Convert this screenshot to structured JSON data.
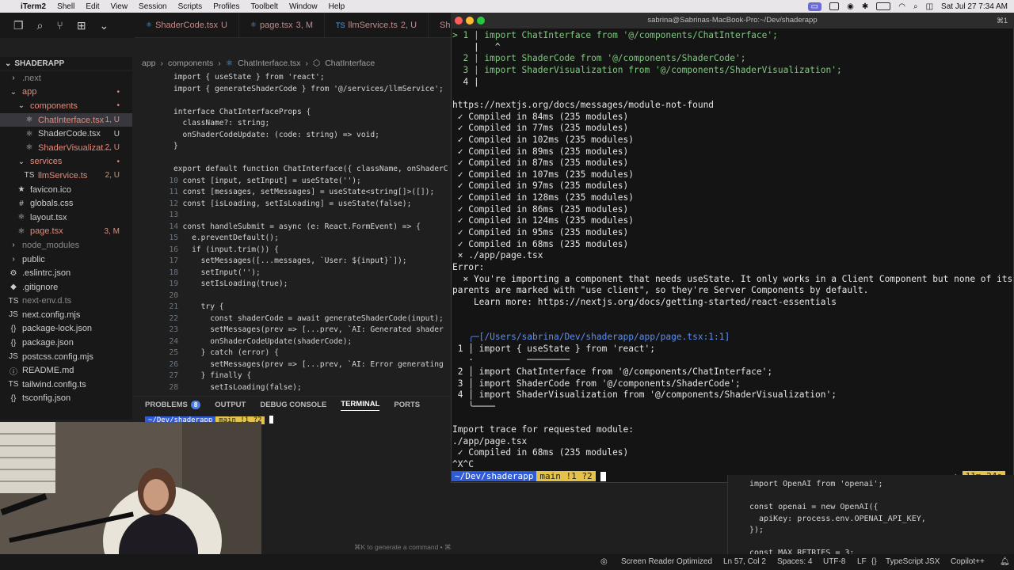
{
  "menubar": {
    "items": [
      "iTerm2",
      "Shell",
      "Edit",
      "View",
      "Session",
      "Scripts",
      "Profiles",
      "Toolbelt",
      "Window",
      "Help"
    ],
    "datetime": "Sat Jul 27  7:34 AM"
  },
  "vscode": {
    "tabs": [
      {
        "name": "ShaderCode.tsx",
        "badge": "U"
      },
      {
        "name": "page.tsx",
        "badge": "3, M"
      },
      {
        "name": "llmService.ts",
        "badge": "2, U"
      },
      {
        "name": "Shader",
        "badge": ""
      }
    ],
    "explorer_title": "SHADERAPP",
    "tree": [
      {
        "label": ".next",
        "cls": "grey",
        "indent": 1,
        "icon": "›",
        "status": ""
      },
      {
        "label": "app",
        "cls": "red",
        "indent": 1,
        "icon": "⌄",
        "status": "•"
      },
      {
        "label": "components",
        "cls": "red",
        "indent": 2,
        "icon": "⌄",
        "status": "•"
      },
      {
        "label": "ChatInterface.tsx",
        "cls": "red",
        "indent": 3,
        "icon": "⚛",
        "status": "1, U",
        "selected": true
      },
      {
        "label": "ShaderCode.tsx",
        "cls": "normal",
        "indent": 3,
        "icon": "⚛",
        "status": "U"
      },
      {
        "label": "ShaderVisualizat...",
        "cls": "red",
        "indent": 3,
        "icon": "⚛",
        "status": "2, U"
      },
      {
        "label": "services",
        "cls": "red",
        "indent": 2,
        "icon": "⌄",
        "status": "•"
      },
      {
        "label": "llmService.ts",
        "cls": "red",
        "indent": 3,
        "icon": "TS",
        "status": "2, U"
      },
      {
        "label": "favicon.ico",
        "cls": "normal",
        "indent": 2,
        "icon": "★",
        "status": ""
      },
      {
        "label": "globals.css",
        "cls": "normal",
        "indent": 2,
        "icon": "#",
        "status": ""
      },
      {
        "label": "layout.tsx",
        "cls": "normal",
        "indent": 2,
        "icon": "⚛",
        "status": ""
      },
      {
        "label": "page.tsx",
        "cls": "red",
        "indent": 2,
        "icon": "⚛",
        "status": "3, M"
      },
      {
        "label": "node_modules",
        "cls": "grey",
        "indent": 1,
        "icon": "›",
        "status": ""
      },
      {
        "label": "public",
        "cls": "normal",
        "indent": 1,
        "icon": "›",
        "status": ""
      },
      {
        "label": ".eslintrc.json",
        "cls": "normal",
        "indent": 1,
        "icon": "⚙",
        "status": ""
      },
      {
        "label": ".gitignore",
        "cls": "normal",
        "indent": 1,
        "icon": "◆",
        "status": ""
      },
      {
        "label": "next-env.d.ts",
        "cls": "grey",
        "indent": 1,
        "icon": "TS",
        "status": ""
      },
      {
        "label": "next.config.mjs",
        "cls": "normal",
        "indent": 1,
        "icon": "JS",
        "status": ""
      },
      {
        "label": "package-lock.json",
        "cls": "normal",
        "indent": 1,
        "icon": "{}",
        "status": ""
      },
      {
        "label": "package.json",
        "cls": "normal",
        "indent": 1,
        "icon": "{}",
        "status": ""
      },
      {
        "label": "postcss.config.mjs",
        "cls": "normal",
        "indent": 1,
        "icon": "JS",
        "status": ""
      },
      {
        "label": "README.md",
        "cls": "normal",
        "indent": 1,
        "icon": "ⓘ",
        "status": ""
      },
      {
        "label": "tailwind.config.ts",
        "cls": "normal",
        "indent": 1,
        "icon": "TS",
        "status": ""
      },
      {
        "label": "tsconfig.json",
        "cls": "normal",
        "indent": 1,
        "icon": "{}",
        "status": ""
      }
    ],
    "breadcrumb": [
      "app",
      "components",
      "ChatInterface.tsx",
      "ChatInterface"
    ],
    "code": [
      {
        "n": "",
        "t": "import { useState } from 'react';"
      },
      {
        "n": "",
        "t": "import { generateShaderCode } from '@/services/llmService';"
      },
      {
        "n": "",
        "t": ""
      },
      {
        "n": "",
        "t": "interface ChatInterfaceProps {"
      },
      {
        "n": "",
        "t": "  className?: string;"
      },
      {
        "n": "",
        "t": "  onShaderCodeUpdate: (code: string) => void;"
      },
      {
        "n": "",
        "t": "}"
      },
      {
        "n": "",
        "t": ""
      },
      {
        "n": "",
        "t": "export default function ChatInterface({ className, onShaderC"
      },
      {
        "n": "10",
        "t": "  const [input, setInput] = useState('');"
      },
      {
        "n": "11",
        "t": "  const [messages, setMessages] = useState<string[]>([]);"
      },
      {
        "n": "12",
        "t": "  const [isLoading, setIsLoading] = useState(false);"
      },
      {
        "n": "13",
        "t": ""
      },
      {
        "n": "14",
        "t": "  const handleSubmit = async (e: React.FormEvent) => {"
      },
      {
        "n": "15",
        "t": "    e.preventDefault();"
      },
      {
        "n": "16",
        "t": "    if (input.trim()) {"
      },
      {
        "n": "17",
        "t": "      setMessages([...messages, `User: ${input}`]);"
      },
      {
        "n": "18",
        "t": "      setInput('');"
      },
      {
        "n": "19",
        "t": "      setIsLoading(true);"
      },
      {
        "n": "20",
        "t": ""
      },
      {
        "n": "21",
        "t": "      try {"
      },
      {
        "n": "22",
        "t": "        const shaderCode = await generateShaderCode(input);"
      },
      {
        "n": "23",
        "t": "        setMessages(prev => [...prev, `AI: Generated shader"
      },
      {
        "n": "24",
        "t": "        onShaderCodeUpdate(shaderCode);"
      },
      {
        "n": "25",
        "t": "      } catch (error) {"
      },
      {
        "n": "26",
        "t": "        setMessages(prev => [...prev, `AI: Error generating"
      },
      {
        "n": "27",
        "t": "      } finally {"
      },
      {
        "n": "28",
        "t": "        setIsLoading(false);"
      }
    ],
    "panel_tabs": [
      "PROBLEMS",
      "OUTPUT",
      "DEBUG CONSOLE",
      "TERMINAL",
      "PORTS"
    ],
    "problems_count": "8",
    "term_prompt_dir": "~/Dev/shaderapp",
    "term_prompt_git": "main !1 ?2",
    "hint": "⌘K to generate a command • ⌘/ to autocomplete"
  },
  "iterm": {
    "title": "sabrina@Sabrinas-MacBook-Pro:~/Dev/shaderapp",
    "lines": [
      "> 1 | import ChatInterface from '@/components/ChatInterface';",
      "    |   ^",
      "  2 | import ShaderCode from '@/components/ShaderCode';",
      "  3 | import ShaderVisualization from '@/components/ShaderVisualization';",
      "  4 |",
      "",
      "https://nextjs.org/docs/messages/module-not-found",
      " ✓ Compiled in 84ms (235 modules)",
      " ✓ Compiled in 77ms (235 modules)",
      " ✓ Compiled in 102ms (235 modules)",
      " ✓ Compiled in 89ms (235 modules)",
      " ✓ Compiled in 87ms (235 modules)",
      " ✓ Compiled in 107ms (235 modules)",
      " ✓ Compiled in 97ms (235 modules)",
      " ✓ Compiled in 128ms (235 modules)",
      " ✓ Compiled in 86ms (235 modules)",
      " ✓ Compiled in 124ms (235 modules)",
      " ✓ Compiled in 95ms (235 modules)",
      " ✓ Compiled in 68ms (235 modules)",
      " × ./app/page.tsx",
      "Error:",
      "  × You're importing a component that needs useState. It only works in a Client Component but none of its",
      "parents are marked with \"use client\", so they're Server Components by default.",
      "    Learn more: https://nextjs.org/docs/getting-started/react-essentials",
      "",
      "",
      "   ╭─[/Users/sabrina/Dev/shaderapp/app/page.tsx:1:1]",
      " 1 │ import { useState } from 'react';",
      "   ·          ────────",
      " 2 │ import ChatInterface from '@/components/ChatInterface';",
      " 3 │ import ShaderCode from '@/components/ShaderCode';",
      " 4 │ import ShaderVisualization from '@/components/ShaderVisualization';",
      "   ╰────",
      "",
      "Import trace for requested module:",
      "./app/page.tsx",
      " ✓ Compiled in 68ms (235 modules)",
      "^X^C"
    ],
    "prompt_dir": "~/Dev/shaderapp",
    "prompt_git": "main !1 ?2",
    "prompt_time": "11m 24s"
  },
  "fragment": [
    "import OpenAI from 'openai';",
    "",
    "const openai = new OpenAI({",
    "  apiKey: process.env.OPENAI_API_KEY,",
    "});",
    "",
    "const MAX_RETRIES = 3;"
  ],
  "statusbar": {
    "screen_reader": "Screen Reader Optimized",
    "position": "Ln 57, Col 2",
    "spaces": "Spaces: 4",
    "encoding": "UTF-8",
    "eol": "LF",
    "language": "TypeScript JSX",
    "copilot": "Copilot++"
  }
}
